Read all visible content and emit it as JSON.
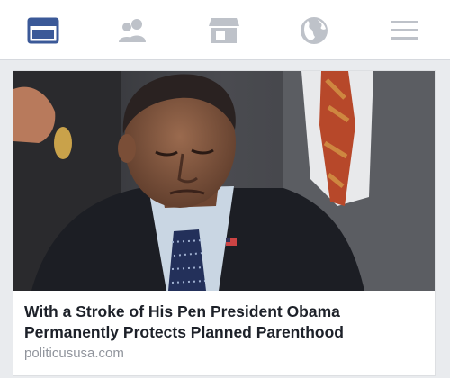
{
  "top_nav": {
    "items": [
      {
        "icon": "news-feed-icon",
        "active": true
      },
      {
        "icon": "friends-icon",
        "active": false
      },
      {
        "icon": "marketplace-icon",
        "active": false
      },
      {
        "icon": "globe-icon",
        "active": false
      },
      {
        "icon": "menu-icon",
        "active": false
      }
    ],
    "active_color": "#3b5998",
    "inactive_color": "#bec2c9"
  },
  "link_card": {
    "headline": "With a Stroke of His Pen President Obama Permanently Protects Planned Parenthood",
    "domain": "politicususa.com"
  }
}
